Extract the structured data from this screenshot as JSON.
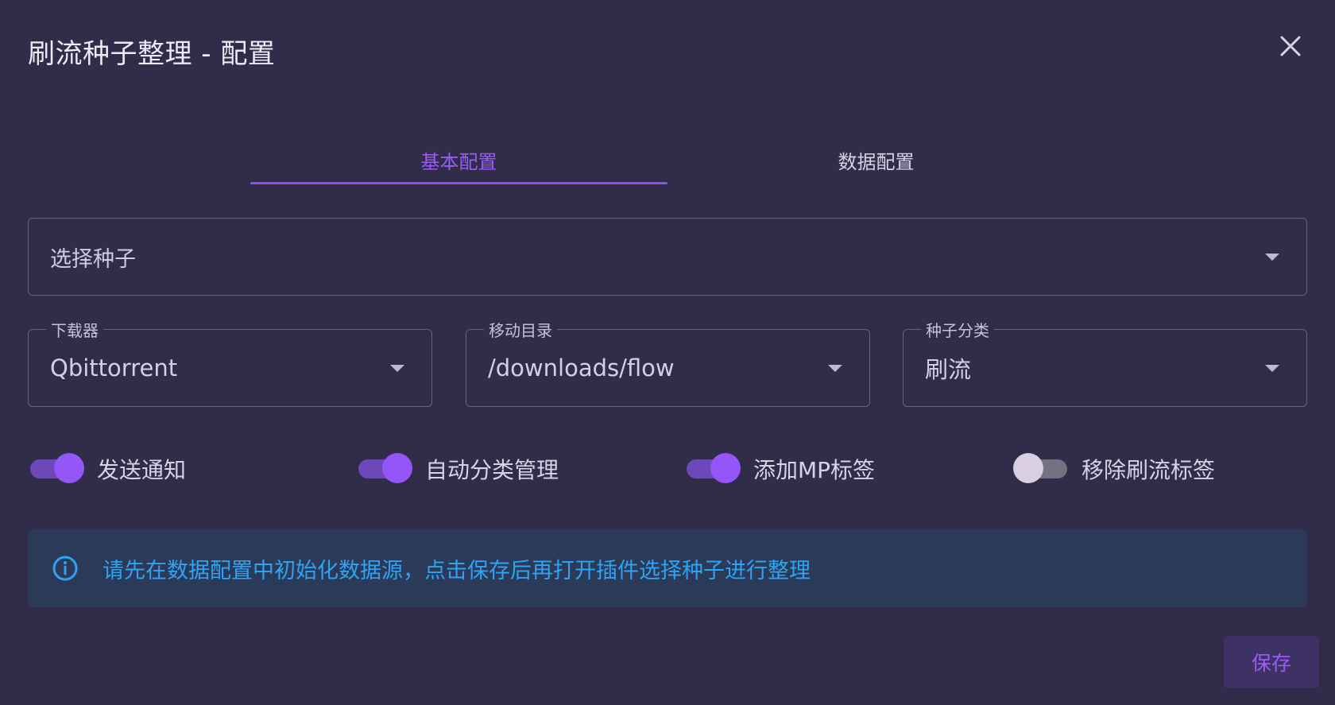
{
  "dialog": {
    "title": "刷流种子整理 - 配置",
    "close_icon": "close-icon"
  },
  "tabs": [
    {
      "label": "基本配置",
      "active": true
    },
    {
      "label": "数据配置",
      "active": false
    }
  ],
  "torrent_select": {
    "placeholder": "选择种子"
  },
  "fields": [
    {
      "label": "下载器",
      "value": "Qbittorrent"
    },
    {
      "label": "移动目录",
      "value": "/downloads/flow"
    },
    {
      "label": "种子分类",
      "value": "刷流"
    }
  ],
  "switches": [
    {
      "label": "发送通知",
      "on": true
    },
    {
      "label": "自动分类管理",
      "on": true
    },
    {
      "label": "添加MP标签",
      "on": true
    },
    {
      "label": "移除刷流标签",
      "on": false
    }
  ],
  "alert": {
    "icon": "info-icon",
    "text": "请先在数据配置中初始化数据源，点击保存后再打开插件选择种子进行整理"
  },
  "actions": {
    "save_label": "保存"
  },
  "colors": {
    "background": "#302c49",
    "accent": "#9a5cf5",
    "info": "#2ea3f2",
    "alert_bg": "#2c3a59"
  }
}
